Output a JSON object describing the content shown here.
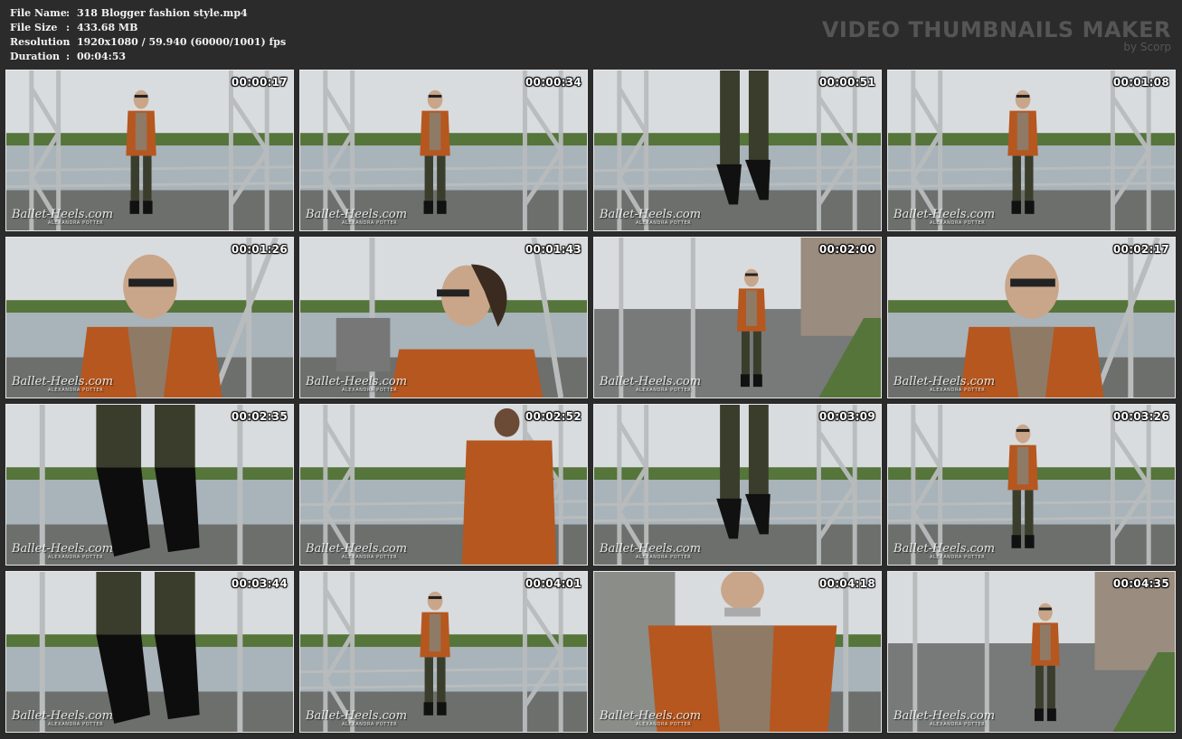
{
  "meta": {
    "file_name_label": "File Name",
    "file_name": "318 Blogger fashion style.mp4",
    "file_size_label": "File Size",
    "file_size": "433.68 MB",
    "resolution_label": "Resolution",
    "resolution": "1920x1080 / 59.940 (60000/1001) fps",
    "duration_label": "Duration",
    "duration": "00:04:53",
    "separator": ":"
  },
  "brand": {
    "title": "VIDEO THUMBNAILS MAKER",
    "subtitle": "by Scorp"
  },
  "watermark": {
    "main": "Ballet-Heels.com",
    "sub": "ALEXANDRA POTTER"
  },
  "colors": {
    "background": "#2b2b2b",
    "jacket": "#b5571f",
    "pants": "#3b3d2c",
    "sky": "#d9dcdf",
    "water": "#a9b3ba",
    "steel": "#b9bcbd",
    "greenery": "#55753a"
  },
  "thumbnails": [
    {
      "time": "00:00:17",
      "scene": "full"
    },
    {
      "time": "00:00:34",
      "scene": "full"
    },
    {
      "time": "00:00:51",
      "scene": "legs"
    },
    {
      "time": "00:01:08",
      "scene": "full"
    },
    {
      "time": "00:01:26",
      "scene": "closeup"
    },
    {
      "time": "00:01:43",
      "scene": "profile"
    },
    {
      "time": "00:02:00",
      "scene": "walkway"
    },
    {
      "time": "00:02:17",
      "scene": "closeup"
    },
    {
      "time": "00:02:35",
      "scene": "boots"
    },
    {
      "time": "00:02:52",
      "scene": "back"
    },
    {
      "time": "00:03:09",
      "scene": "legs"
    },
    {
      "time": "00:03:26",
      "scene": "full"
    },
    {
      "time": "00:03:44",
      "scene": "boots"
    },
    {
      "time": "00:04:01",
      "scene": "full"
    },
    {
      "time": "00:04:18",
      "scene": "lowangle"
    },
    {
      "time": "00:04:35",
      "scene": "walkway"
    }
  ]
}
